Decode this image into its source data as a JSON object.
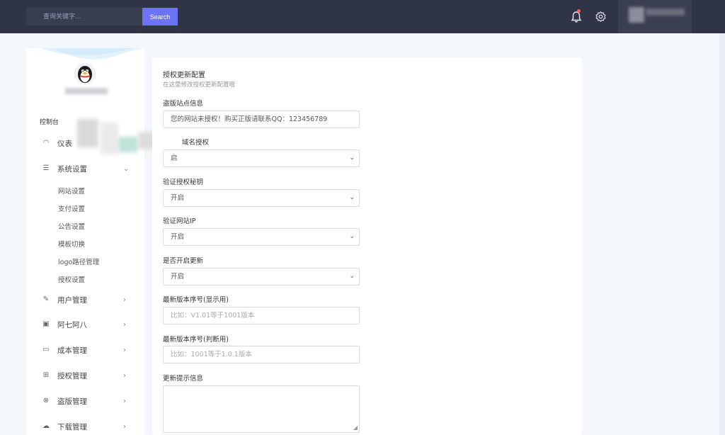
{
  "topbar": {
    "search_placeholder": "查询关键字...",
    "search_button": "Search"
  },
  "sidebar": {
    "section_label": "控制台",
    "items": [
      {
        "label": "仪表",
        "icon": "gauge-icon"
      },
      {
        "label": "系统设置",
        "icon": "list-icon",
        "arrow": "⌄"
      },
      {
        "label": "用户管理",
        "icon": "user-edit-icon",
        "arrow": "›"
      },
      {
        "label": "阿七阿八",
        "icon": "calendar-icon",
        "arrow": "›"
      },
      {
        "label": "成本管理",
        "icon": "wallet-icon",
        "arrow": "›"
      },
      {
        "label": "授权管理",
        "icon": "grid-icon",
        "arrow": "›"
      },
      {
        "label": "盗版管理",
        "icon": "close-circle-icon",
        "arrow": "›"
      },
      {
        "label": "下载管理",
        "icon": "cloud-download-icon",
        "arrow": "›"
      }
    ],
    "submenu": [
      "网站设置",
      "支付设置",
      "公告设置",
      "模板切换",
      "logo路径管理",
      "授权设置"
    ]
  },
  "panel": {
    "title": "授权更新配置",
    "subtitle": "在这里修改授权更新配置哦",
    "fields": [
      {
        "label": "盗版站点信息",
        "value": "您的网站未授权！购买正版请联系QQ：123456789"
      },
      {
        "label": "域名授权",
        "value": "启"
      },
      {
        "label": "验证授权秘钥",
        "value": "开启"
      },
      {
        "label": "验证网站IP",
        "value": "开启"
      },
      {
        "label": "是否开启更新",
        "value": "开启"
      },
      {
        "label": "最新版本序号(显示用)",
        "placeholder": "比如：V1.01等于1001版本"
      },
      {
        "label": "最新版本序号(判断用)",
        "placeholder": "比如：1001等于1.0.1版本"
      },
      {
        "label": "更新提示信息"
      }
    ]
  }
}
